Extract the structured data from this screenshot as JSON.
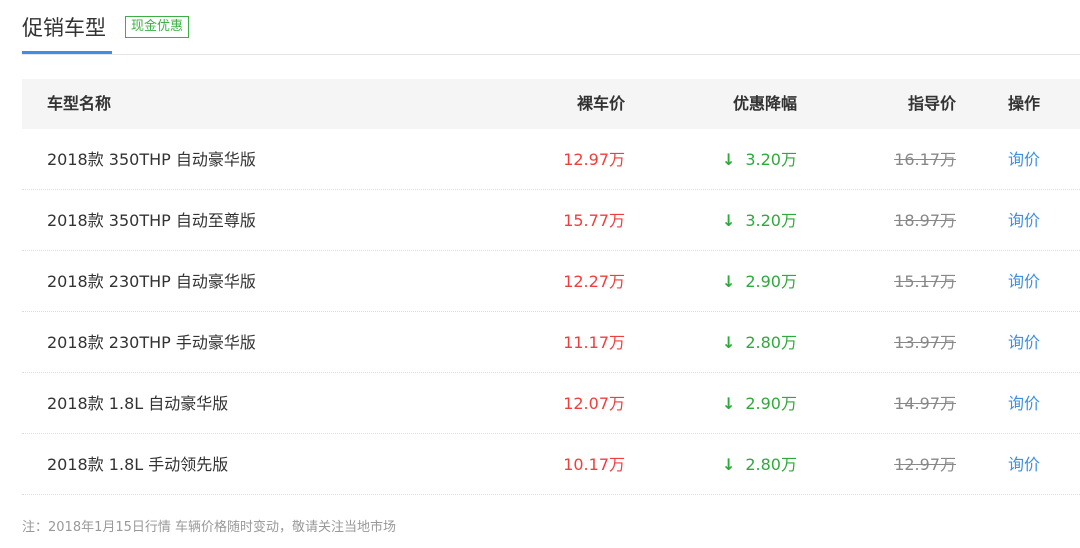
{
  "header": {
    "title": "促销车型",
    "badge": "现金优惠",
    "accent_color": "#3d8fe6"
  },
  "table": {
    "columns": {
      "name": "车型名称",
      "price": "裸车价",
      "discount": "优惠降幅",
      "guide": "指导价",
      "action": "操作"
    },
    "arrow_icon": "↓",
    "rows": [
      {
        "name": "2018款 350THP 自动豪华版",
        "price": "12.97万",
        "discount": "3.20万",
        "guide": "16.17万",
        "action": "询价"
      },
      {
        "name": "2018款 350THP 自动至尊版",
        "price": "15.77万",
        "discount": "3.20万",
        "guide": "18.97万",
        "action": "询价"
      },
      {
        "name": "2018款 230THP 自动豪华版",
        "price": "12.27万",
        "discount": "2.90万",
        "guide": "15.17万",
        "action": "询价"
      },
      {
        "name": "2018款 230THP 手动豪华版",
        "price": "11.17万",
        "discount": "2.80万",
        "guide": "13.97万",
        "action": "询价"
      },
      {
        "name": "2018款 1.8L 自动豪华版",
        "price": "12.07万",
        "discount": "2.90万",
        "guide": "14.97万",
        "action": "询价"
      },
      {
        "name": "2018款 1.8L 手动领先版",
        "price": "10.17万",
        "discount": "2.80万",
        "guide": "12.97万",
        "action": "询价"
      }
    ]
  },
  "note": "注：2018年1月15日行情 车辆价格随时变动，敬请关注当地市场",
  "colors": {
    "price": "#f23d3d",
    "discount": "#2eaa3a",
    "link": "#3d8fe6",
    "badge": "#3cb043"
  }
}
